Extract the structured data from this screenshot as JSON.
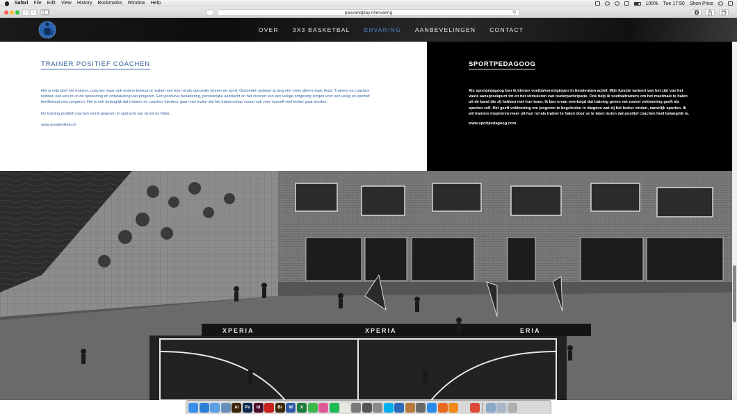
{
  "menubar": {
    "app_name": "Safari",
    "items": [
      "File",
      "Edit",
      "View",
      "History",
      "Bookmarks",
      "Window",
      "Help"
    ],
    "clock": "Tue 17:50",
    "user": "Shon Price",
    "battery": "100%"
  },
  "browser": {
    "url": "passandplay.nl/ervaring",
    "back_glyph": "‹",
    "forward_glyph": "›",
    "reload_glyph": "↻"
  },
  "nav": {
    "links": [
      "OVER",
      "3X3 BASKETBAL",
      "ERVARING",
      "AANBEVELINGEN",
      "CONTACT"
    ],
    "active_index": 2,
    "active_color": "#4a86c8"
  },
  "left": {
    "title": "TRAINER POSITIEF COACHEN",
    "paragraphs": [
      "Het is mijn doel om trainers, coaches maar ook ouders bewust te maken van hun rol als opvoeder binnen de sport. Opvoeden gebeurt al lang niet meer alleen maar thuis. Trainers en coaches hebben ook een rol in de opvoeding en ontwikkeling van jongeren. Een positieve benadering, persoonlijke aandacht en het creëren van een veilige omgeving zorgen voor een veilig en sportief leerklimaat voor jongeren. Het is ook belangrijk dat trainers en coaches hierdoor gaan een inzien dat het trainerschap vooral ook voor hunzelf veel leuker gaat worden.",
      "De training positief coachen wordt gegeven in opdracht van Groot en Klein.",
      "www.grootenklein.nl"
    ],
    "text_color": "#2f5d9a"
  },
  "right": {
    "title": "SPORTPEDAGOOG",
    "paragraphs": [
      "Als sportpedagoog ben ik binnen voetbalverenigingen in Amsterdam actief. Mijn functie varieert van het zijn van het vaste aanspreekpunt tot en het stimuleren van ouderparticipatie. Ook help ik voetbaltrainers om het maximale te halen uit de band die zij hebben met hun team. Ik ben ervan overtuigd dat training geven net zoveel voldoening geeft als sporten zelf. Het geeft voldoening om jongeren te begeleiden in datgene wat zij het leukst vinden, namelijk sporten. Ik wil trainers inspireren meer uit hun rol als trainer te halen door ze te laten inzien dat positief coachen heel belangrijk is.",
      "www.sportpedagoog.com"
    ]
  },
  "photo": {
    "banner_text": [
      "XPERIA",
      "XPERIA",
      "ERIA"
    ]
  },
  "dock": {
    "apps": [
      {
        "name": "finder-icon",
        "label": "",
        "color": "#3b8ee8"
      },
      {
        "name": "safari-icon",
        "label": "",
        "color": "#2f7fd8"
      },
      {
        "name": "mail-icon",
        "label": "",
        "color": "#5aa0e8"
      },
      {
        "name": "preview-icon",
        "label": "",
        "color": "#6a8fb8"
      },
      {
        "name": "illustrator-icon",
        "label": "Ai",
        "color": "#3a2508"
      },
      {
        "name": "photoshop-icon",
        "label": "Ps",
        "color": "#0c2a4a"
      },
      {
        "name": "indesign-icon",
        "label": "Id",
        "color": "#4a0a28"
      },
      {
        "name": "acrobat-icon",
        "label": "",
        "color": "#c8201e"
      },
      {
        "name": "bridge-icon",
        "label": "Br",
        "color": "#3a2a08"
      },
      {
        "name": "word-icon",
        "label": "W",
        "color": "#2a5aa8"
      },
      {
        "name": "excel-icon",
        "label": "X",
        "color": "#1e7a3e"
      },
      {
        "name": "messages-icon",
        "label": "",
        "color": "#3ab84a"
      },
      {
        "name": "itunes-icon",
        "label": "",
        "color": "#e05a9a"
      },
      {
        "name": "spotify-icon",
        "label": "",
        "color": "#1db954"
      },
      {
        "name": "notes-icon",
        "label": "",
        "color": "#e8e8e0"
      },
      {
        "name": "settings-icon",
        "label": "",
        "color": "#7a7a7a"
      },
      {
        "name": "calculator-icon",
        "label": "",
        "color": "#555555"
      },
      {
        "name": "keychain-icon",
        "label": "",
        "color": "#8a8a8a"
      },
      {
        "name": "skype-icon",
        "label": "",
        "color": "#00aff0"
      },
      {
        "name": "xcode-icon",
        "label": "",
        "color": "#2a6ab8"
      },
      {
        "name": "brush-icon",
        "label": "",
        "color": "#b87a3a"
      },
      {
        "name": "automator-icon",
        "label": "",
        "color": "#6a6a6a"
      },
      {
        "name": "app-store-icon",
        "label": "",
        "color": "#2a8ae8"
      },
      {
        "name": "firefox-icon",
        "label": "",
        "color": "#e86a1e"
      },
      {
        "name": "vlc-icon",
        "label": "",
        "color": "#f08a1a"
      },
      {
        "name": "photos-icon",
        "label": "",
        "color": "#d8d8d8"
      },
      {
        "name": "chrome-icon",
        "label": "",
        "color": "#dc4a38"
      },
      {
        "name": "downloads-icon",
        "label": "",
        "color": "#8aa8c8"
      },
      {
        "name": "documents-icon",
        "label": "",
        "color": "#a8b8c8"
      },
      {
        "name": "trash-icon",
        "label": "",
        "color": "#b0b0b0"
      }
    ]
  }
}
